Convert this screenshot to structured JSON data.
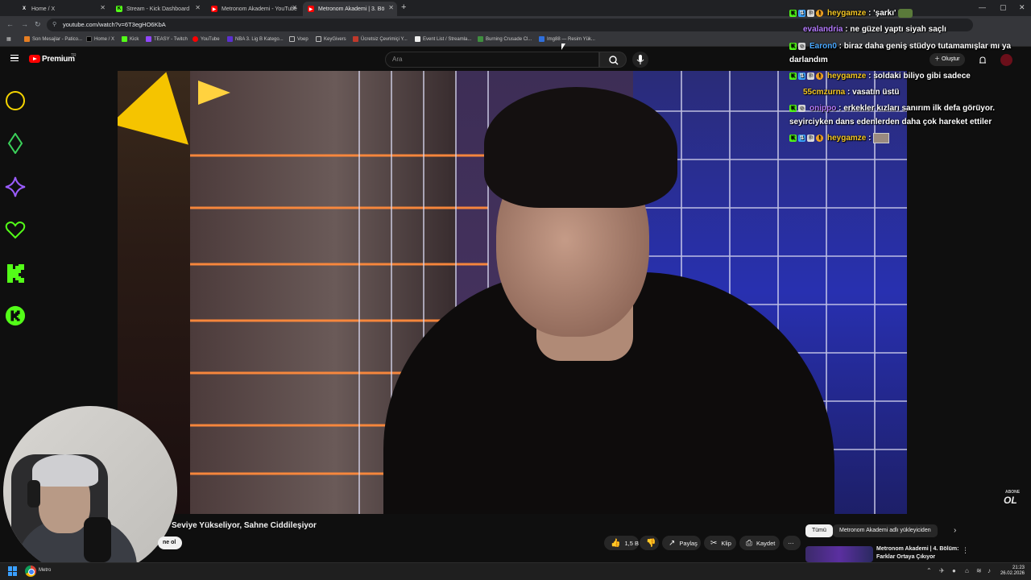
{
  "browser": {
    "tabs": [
      {
        "label": "Home / X",
        "color": "#000000",
        "glyph": "X"
      },
      {
        "label": "Stream - Kick Dashboard",
        "color": "#53fc18",
        "glyph": "K"
      },
      {
        "label": "Metronom Akademi - YouTube",
        "color": "#ff0000",
        "glyph": "▶"
      },
      {
        "label": "Metronom Akademi | 3. Bö",
        "color": "#ff0000",
        "glyph": "▶"
      }
    ],
    "url": "youtube.com/watch?v=6T3egHO6KbA",
    "bookmarks": [
      "Son Mesajlar - Patico...",
      "Home / X",
      "Kick",
      "TEASY - Twitch",
      "YouTube",
      "NBA 3. Lig B Katego...",
      "Voep",
      "KeyGivers",
      "Ücretsiz Çevrimiçi Y...",
      "Event List / Streamla...",
      "Burning Crusade Cl...",
      "Img88 — Resim Yük..."
    ]
  },
  "youtube": {
    "brand": "Premium",
    "region": "TR",
    "search_placeholder": "Ara",
    "create_label": "Oluştur",
    "video_title": "Seviye Yükseliyor, Sahne Ciddileşiyor",
    "subscribe_label": "ne ol",
    "likes": "1,5 B",
    "share_label": "Paylaş",
    "clip_label": "Klip",
    "save_label": "Kaydet",
    "watermark_top": "ABONE",
    "watermark_bottom": "OL",
    "chips": [
      "Tümü",
      "Metronom Akademi adlı yükleyiciden"
    ],
    "recommendation_title": "Metronom Akademi | 4. Bölüm: Farklar Ortaya Çıkıyor"
  },
  "chat": [
    {
      "user": "heygamze",
      "color": "#f3c623",
      "text": "'şarkı'",
      "badges": [
        "k",
        "b",
        "w",
        "o"
      ],
      "emote": true
    },
    {
      "user": "evalandria",
      "color": "#b57bff",
      "text": "ne güzel yaptı siyah saçlı",
      "badges": []
    },
    {
      "user": "Earon0",
      "color": "#4aa8ff",
      "text": "biraz daha geniş stüdyo tutamamışlar mı ya darlandım",
      "badges": [
        "k",
        "w"
      ]
    },
    {
      "user": "heygamze",
      "color": "#f3c623",
      "text": "soldaki biliyo gibi sadece",
      "badges": [
        "k",
        "b",
        "w",
        "o"
      ]
    },
    {
      "user": "55cmzurna",
      "color": "#f3c623",
      "text": "vasatın üstü",
      "badges": []
    },
    {
      "user": "onippo",
      "color": "#b57bff",
      "text": "erkekler kızları sanırım ilk defa görüyor. seyirciyken dans edenlerden daha çok hareket ettiler",
      "badges": [
        "k",
        "w"
      ]
    },
    {
      "user": "heygamze",
      "color": "#f3c623",
      "text": "",
      "badges": [
        "k",
        "b",
        "w",
        "o"
      ],
      "emote_img": true
    }
  ],
  "taskbar": {
    "app_label": "Metro",
    "time": "21:23",
    "date": "26.02.2026"
  },
  "overlay_icons": [
    "circle-icon",
    "diamond-icon",
    "sparkle-icon",
    "heart-icon",
    "kick-k-icon",
    "kick-round-icon"
  ]
}
